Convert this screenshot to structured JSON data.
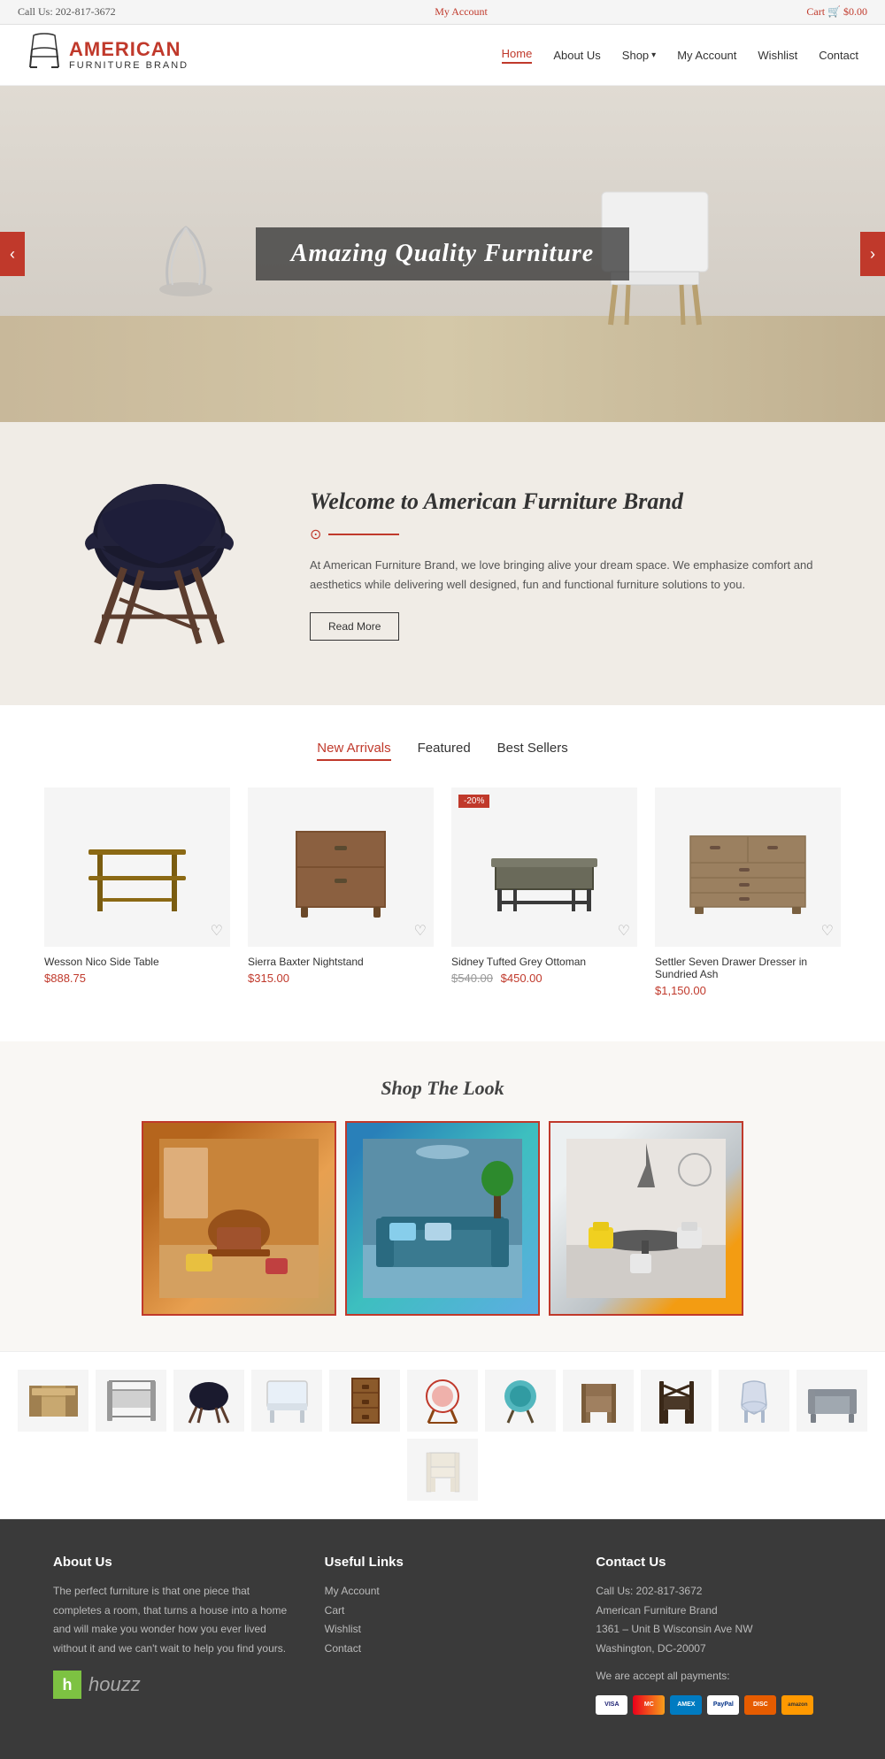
{
  "topbar": {
    "call_label": "Call Us: 202-817-3672",
    "account_label": "My Account",
    "cart_label": "Cart",
    "cart_amount": "$0.00"
  },
  "header": {
    "brand_name": "AMERICAN",
    "brand_sub": "FURNITURE BRAND",
    "nav_items": [
      {
        "label": "Home",
        "active": true
      },
      {
        "label": "About Us",
        "active": false
      },
      {
        "label": "Shop",
        "active": false,
        "has_dropdown": true
      },
      {
        "label": "My Account",
        "active": false
      },
      {
        "label": "Wishlist",
        "active": false
      },
      {
        "label": "Contact",
        "active": false
      }
    ]
  },
  "hero": {
    "headline": "Amazing Quality Furniture",
    "prev_label": "‹",
    "next_label": "›"
  },
  "welcome": {
    "heading": "Welcome to American Furniture Brand",
    "body": "At American Furniture Brand, we love bringing alive your dream space. We emphasize comfort and aesthetics while delivering well designed, fun and functional furniture solutions to you.",
    "read_more_label": "Read More"
  },
  "products": {
    "tabs": [
      {
        "label": "New Arrivals",
        "active": true
      },
      {
        "label": "Featured",
        "active": false
      },
      {
        "label": "Best Sellers",
        "active": false
      }
    ],
    "items": [
      {
        "name": "Wesson Nico Side Table",
        "price": "$888.75",
        "old_price": null,
        "badge": null
      },
      {
        "name": "Sierra Baxter Nightstand",
        "price": "$315.00",
        "old_price": null,
        "badge": null
      },
      {
        "name": "Sidney Tufted Grey Ottoman",
        "price": "$450.00",
        "old_price": "$540.00",
        "badge": "-20%"
      },
      {
        "name": "Settler Seven Drawer Dresser in Sundried Ash",
        "price": "$1,150.00",
        "old_price": null,
        "badge": null
      }
    ]
  },
  "shop_look": {
    "heading": "Shop The Look"
  },
  "footer": {
    "about_heading": "About Us",
    "about_text": "The perfect furniture is that one piece that completes a room, that turns a house into a home and will make you wonder how you ever lived without it and we can't wait to help you find yours.",
    "links_heading": "Useful Links",
    "links": [
      "My Account",
      "Cart",
      "Wishlist",
      "Contact"
    ],
    "contact_heading": "Contact Us",
    "contact_phone": "Call Us: 202-817-3672",
    "contact_brand": "American Furniture Brand",
    "contact_address": "1361 – Unit B Wisconsin Ave NW",
    "contact_city": "Washington, DC-20007",
    "payments_label": "We are accept all payments:",
    "payment_icons": [
      "VISA",
      "MC",
      "AMEX",
      "PayPal",
      "DISC",
      "AMZ"
    ]
  }
}
